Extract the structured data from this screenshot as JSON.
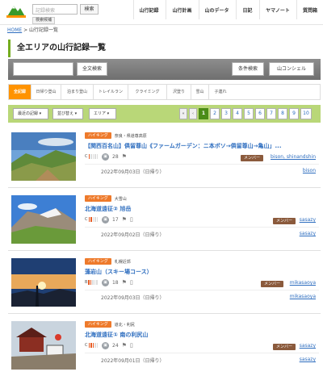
{
  "header": {
    "search_placeholder": "記録検索",
    "search_button": "検索",
    "dropdown_tip": "検索候補",
    "nav": [
      "山行記録",
      "山行計画",
      "山のデータ",
      "日記",
      "ヤマノート",
      "質問箱"
    ]
  },
  "breadcrumb": {
    "home": "HOME",
    "separator": " > ",
    "current": "山行記録一覧"
  },
  "page_title": "全エリアの山行記録一覧",
  "search_bar": {
    "fulltext_button": "全文検索",
    "condition_button": "条件検索",
    "concierge_button": "山コンシェル"
  },
  "tabs": [
    "全記録",
    "日帰り登山",
    "泊まり登山",
    "トレイルラン",
    "クライミング",
    "沢登り",
    "雪山",
    "子連れ"
  ],
  "filters": {
    "sort_button": "最近の記録",
    "order_button": "並び替え",
    "area_button": "エリア"
  },
  "pager": {
    "first": "«",
    "prev": "‹",
    "pages": [
      "1",
      "2",
      "3",
      "4",
      "5",
      "6",
      "7",
      "8",
      "9",
      "10"
    ],
    "current": "1"
  },
  "records": [
    {
      "category": "ハイキング",
      "area": "奈良・県道尊高原",
      "title": "【関西百名山】俱留尊山《ファームガーデン：ニ本ボソ→俱留尊山→亀山」...",
      "count": "28",
      "member_badge": "メンバー",
      "users": "bison, shinandshin",
      "date": "2022年09月03日（日帰り）",
      "owner": "bison"
    },
    {
      "category": "ハイキング",
      "area": "大雪山",
      "title": "北海道遠征② 旭岳",
      "count": "17",
      "member_badge": "メンバー",
      "users": "sasazy",
      "date": "2022年09月02日（日帰り）",
      "owner": "sasazy"
    },
    {
      "category": "ハイキング",
      "area": "札幌近郊",
      "title": "藻岩山（スキー場コース）",
      "count": "18",
      "member_badge": "メンバー",
      "users": "mikasaoya",
      "date": "2022年09月03日（日帰り）",
      "owner": "mikasaoya"
    },
    {
      "category": "ハイキング",
      "area": "道北・利尻",
      "title": "北海道遠征① 南の利尻山",
      "count": "24",
      "member_badge": "メンバー",
      "users": "sasazy",
      "date": "2022年09月01日（日帰り）",
      "owner": "sasazy"
    }
  ],
  "colors": {
    "accent_orange": "#ff9300",
    "green_bar": "#b9d778",
    "link_blue": "#2d6dbf",
    "category_orange": "#ee7a2b",
    "member_brown": "#8b5a3c"
  }
}
